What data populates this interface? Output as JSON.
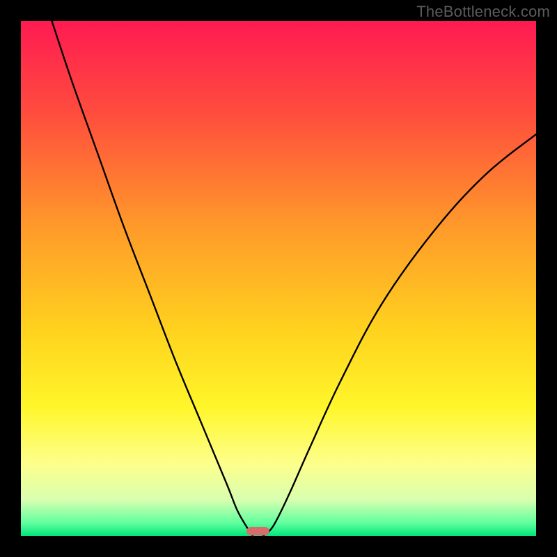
{
  "watermark": {
    "text": "TheBottleneck.com"
  },
  "colors": {
    "frame": "#000000",
    "curve": "#000000",
    "marker": "#d96b6b",
    "gradient_stops": [
      {
        "offset": 0.0,
        "color": "#ff1a52"
      },
      {
        "offset": 0.18,
        "color": "#ff4d3d"
      },
      {
        "offset": 0.4,
        "color": "#ff9a2a"
      },
      {
        "offset": 0.6,
        "color": "#ffd21e"
      },
      {
        "offset": 0.75,
        "color": "#fff62a"
      },
      {
        "offset": 0.86,
        "color": "#fdff8c"
      },
      {
        "offset": 0.93,
        "color": "#d8ffb0"
      },
      {
        "offset": 0.975,
        "color": "#5fff9e"
      },
      {
        "offset": 1.0,
        "color": "#00e57a"
      }
    ]
  },
  "chart_data": {
    "type": "line",
    "title": "",
    "xlabel": "",
    "ylabel": "",
    "xlim": [
      0,
      100
    ],
    "ylim": [
      0,
      100
    ],
    "series": [
      {
        "name": "left-curve",
        "x": [
          6,
          10,
          15,
          20,
          25,
          30,
          35,
          40,
          42,
          44,
          45
        ],
        "y": [
          100,
          88,
          74,
          60,
          47,
          34,
          22,
          10,
          5,
          1.5,
          0
        ]
      },
      {
        "name": "right-curve",
        "x": [
          47,
          49,
          52,
          56,
          62,
          70,
          80,
          90,
          100
        ],
        "y": [
          0,
          2,
          8,
          17,
          30,
          45,
          59,
          70,
          78
        ]
      }
    ],
    "marker": {
      "x_center": 46,
      "width": 4.5,
      "height": 1.6
    },
    "notes": "Two branches meeting near x≈46 at y≈0; left branch starts at top edge (y=100) near x≈6; right branch reaches y≈78 at x=100. Background is a vertical red→yellow→green gradient indicating bottleneck severity (red=high, green=low)."
  }
}
